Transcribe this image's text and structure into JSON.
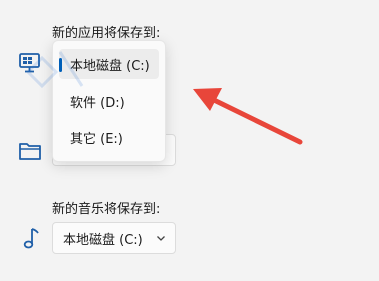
{
  "documents_label": "新的应用将保存到:",
  "dropdown": {
    "options": [
      {
        "label": "本地磁盘 (C:)",
        "selected": true
      },
      {
        "label": "软件 (D:)",
        "selected": false
      },
      {
        "label": "其它 (E:)",
        "selected": false
      }
    ]
  },
  "music_label": "新的音乐将保存到:",
  "music_select": {
    "value": "本地磁盘 (C:)"
  },
  "colors": {
    "accent": "#005fb8",
    "annotation_arrow": "#e8463a"
  },
  "icons": [
    "monitor-icon",
    "folder-icon",
    "music-note-icon",
    "chevron-down-icon"
  ]
}
